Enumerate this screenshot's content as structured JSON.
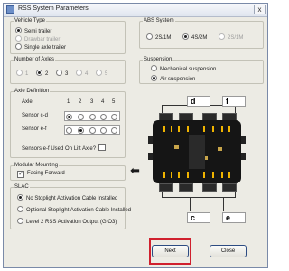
{
  "window": {
    "title": "RSS System Parameters",
    "close_label": "x"
  },
  "vehicle_type": {
    "legend": "Vehicle Type",
    "options": [
      "Semi trailer",
      "Drawbar trailer",
      "Single axle trailer"
    ],
    "selected": "Semi trailer"
  },
  "abs_system": {
    "legend": "ABS System",
    "options": [
      "2S/1M",
      "4S/2M",
      "2S/1M"
    ],
    "selected": "4S/2M"
  },
  "number_of_axles": {
    "legend": "Number of Axles",
    "options": [
      "1",
      "2",
      "3",
      "4",
      "5"
    ],
    "selected": "2"
  },
  "suspension": {
    "legend": "Suspension",
    "options": [
      "Mechanical suspension",
      "Air suspension"
    ],
    "selected": "Air suspension"
  },
  "axle_definition": {
    "legend": "Axle Definition",
    "axle_label": "Axle",
    "axle_numbers": [
      "1",
      "2",
      "3",
      "4",
      "5"
    ],
    "sensor_cd_label": "Sensor c-d",
    "sensor_ef_label": "Sensor e-f",
    "sensor_cd_selected_axle": "1",
    "sensor_ef_selected_axle": "2",
    "lift_axle_question": "Sensors e-f Used On Lift Axle?"
  },
  "diagram": {
    "label_d": "d",
    "label_f": "f",
    "label_c": "c",
    "label_e": "e"
  },
  "modular_mounting": {
    "legend": "Modular Mounting",
    "facing_forward_label": "Facing Forward",
    "facing_forward_checked": true,
    "check_mark": "✓",
    "arrow_glyph": "⬅"
  },
  "slac": {
    "legend": "SLAC",
    "options": [
      "No Stoplight Activation Cable Installed",
      "Optional Stoplight Activation Cable Installed",
      "Level 2 RSS Activation Output (GIO3)"
    ],
    "selected": "No Stoplight Activation Cable Installed"
  },
  "buttons": {
    "next": "Next",
    "close": "Close"
  },
  "colors": {
    "highlight": "#d0202e",
    "module_body": "#151515",
    "module_lanes": "#f0b400"
  }
}
